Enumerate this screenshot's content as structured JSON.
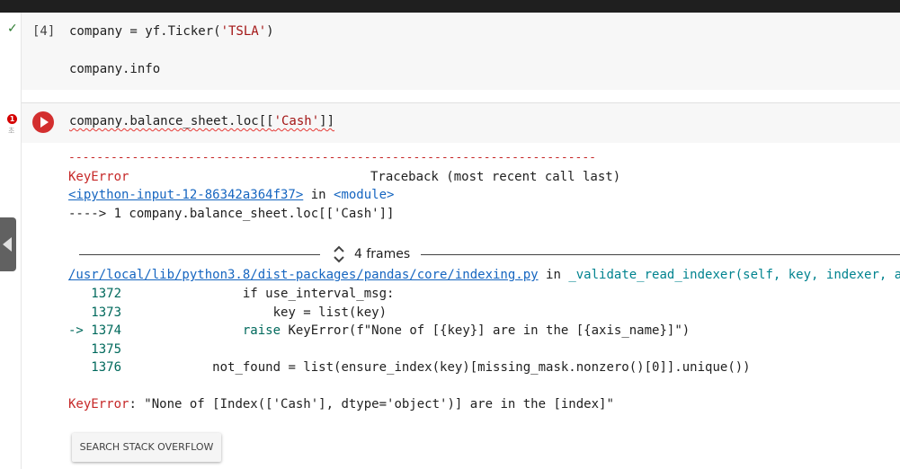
{
  "cell1": {
    "exec_count": "[4]",
    "line1": {
      "before": "company = yf.Ticker(",
      "str": "'TSLA'",
      "after": ")"
    },
    "line2": "company.info"
  },
  "cell2": {
    "error_badge": "1",
    "error_sub": "초",
    "code": {
      "before": "company.balance_sheet.loc[[",
      "str": "'Cash'",
      "after": "]]"
    }
  },
  "output": {
    "dashes": "---------------------------------------------------------------------------",
    "error_name": "KeyError",
    "traceback_header": "Traceback (most recent call last)",
    "input_link": "<ipython-input-12-86342a364f37>",
    "in_word": " in ",
    "module": "<module>",
    "arrow_line": "----> 1 company.balance_sheet.loc[['Cash']]",
    "frames_label": "4 frames",
    "file_link": "/usr/local/lib/python3.8/dist-packages/pandas/core/indexing.py",
    "file_in": " in ",
    "func_sig": "_validate_read_indexer(self, key, indexer, axis)",
    "src_lines": [
      {
        "marker": "   ",
        "num": "1372",
        "code": "                if use_interval_msg:"
      },
      {
        "marker": "   ",
        "num": "1373",
        "code": "                    key = list(key)"
      },
      {
        "marker": "-> ",
        "num": "1374",
        "code": "                raise KeyError(f\"None of [{key}] are in the [{axis_name}]\")"
      },
      {
        "marker": "   ",
        "num": "1375",
        "code": ""
      },
      {
        "marker": "   ",
        "num": "1376",
        "code": "            not_found = list(ensure_index(key)[missing_mask.nonzero()[0]].unique())"
      }
    ],
    "final_error_name": "KeyError",
    "final_error_msg": ": \"None of [Index(['Cash'], dtype='object')] are in the [index]\""
  },
  "so_button": "SEARCH STACK OVERFLOW",
  "colors": {
    "error_red": "#c62828",
    "link_blue": "#1565c0",
    "run_button": "#d32f2f"
  }
}
